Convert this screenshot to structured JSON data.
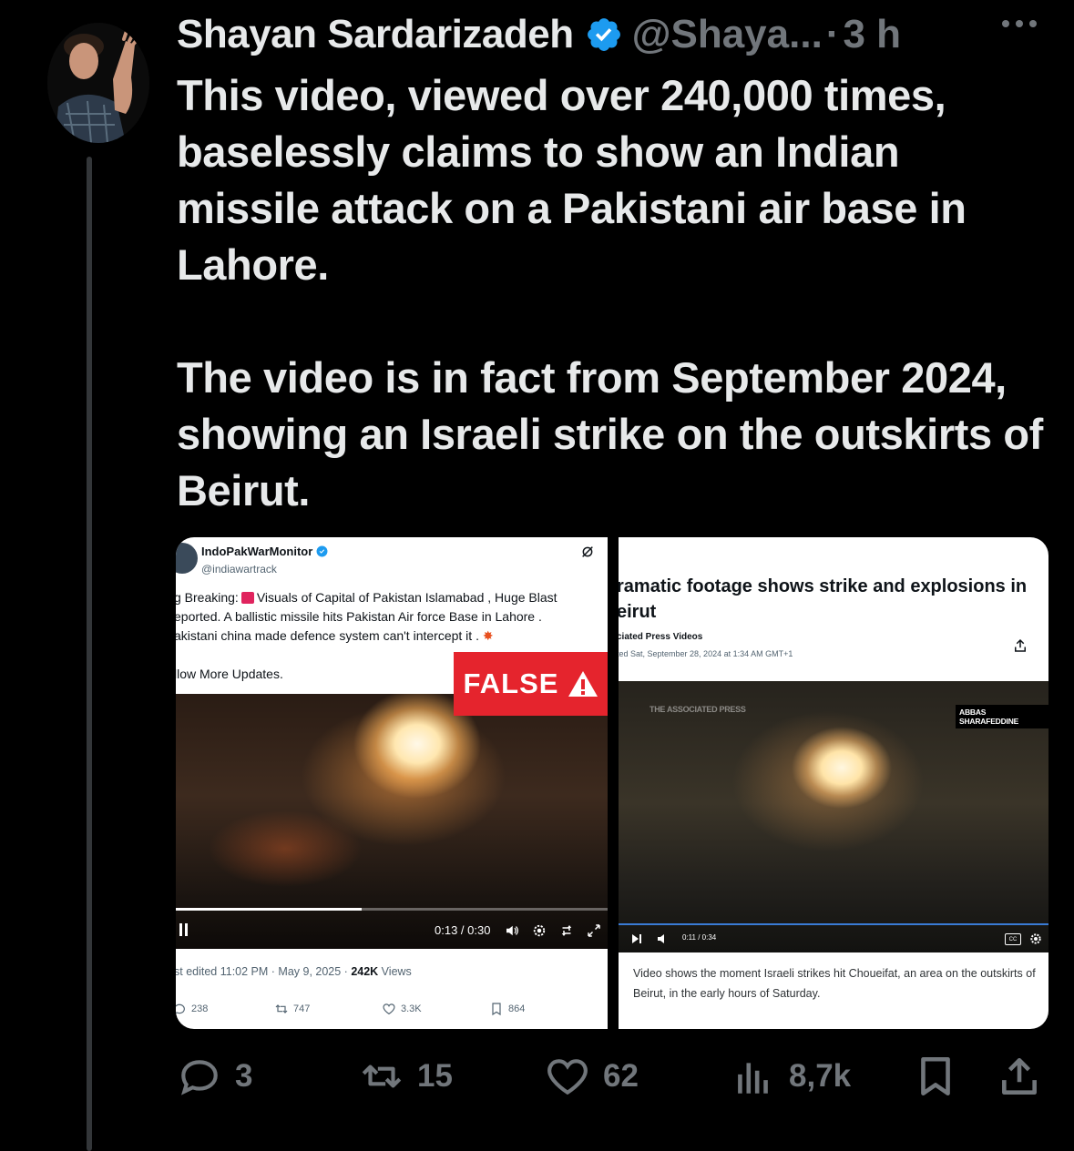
{
  "author": {
    "display_name": "Shayan Sardarizadeh",
    "handle": "@Shaya...",
    "separator": "·",
    "time": "3 h",
    "verified": true,
    "verified_color": "#1d9bf0"
  },
  "tweet": {
    "paragraphs": [
      "This video, viewed over 240,000 times, baselessly claims to show an Indian missile attack on a Pakistani air base in Lahore.",
      "The video is in fact from September 2024, showing an Israeli strike on the outskirts of Beirut."
    ]
  },
  "media": {
    "left_screenshot": {
      "account_name": "IndoPakWarMonitor",
      "account_handle": "@indiawartrack",
      "text_prefix": "g Breaking:",
      "text_line1": "Visuals of Capital of Pakistan Islamabad , Huge Blast",
      "text_line2": "eported. A ballistic missile hits Pakistan Air force Base in Lahore .",
      "text_line3": "akistani china made defence system can't intercept it .",
      "follow_text": "llow More Updates.",
      "badge": "FALSE",
      "badge_color": "#e5242d",
      "video_time": "0:13 / 0:30",
      "video_progress": 0.43,
      "meta_prefix": "st edited 11:02 PM · May 9, 2025 · ",
      "views_count": "242K",
      "views_label": " Views",
      "stats": {
        "replies": "238",
        "reposts": "747",
        "likes": "3.3K",
        "bookmarks": "864"
      }
    },
    "right_screenshot": {
      "headline": "ramatic footage shows strike and explosions in eirut",
      "source": "ciated Press Videos",
      "date": "ted Sat, September 28, 2024 at 1:34 AM GMT+1",
      "watermark": "THE ASSOCIATED PRESS",
      "credit": "ABBAS SHARAFEDDINE",
      "video_time": "0:11  /  0:34",
      "cc_label": "CC",
      "caption": "Video shows the moment Israeli strikes hit Choueifat, an area on the outskirts of Beirut, in the early hours of Saturday."
    }
  },
  "actions": {
    "replies": "3",
    "reposts": "15",
    "likes": "62",
    "views": "8,7k"
  }
}
